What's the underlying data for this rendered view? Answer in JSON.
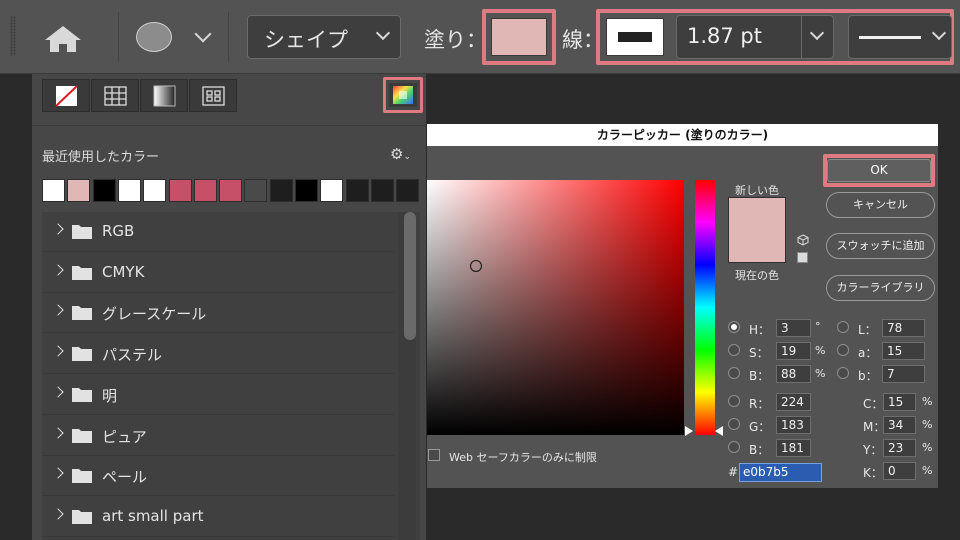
{
  "options_bar": {
    "shape_mode": "シェイプ",
    "fill_label": "塗り：",
    "fill_color": "#e0b7b5",
    "stroke_label": "線：",
    "stroke_width": "1.87 pt",
    "highlight_color": "#e07a82"
  },
  "swatch_panel": {
    "tabs": [
      "none-color-icon",
      "grid-icon",
      "gradient-icon",
      "pattern-icon",
      "color-picker-icon"
    ],
    "recent_label": "最近使用したカラー",
    "recent_colors": [
      "#ffffff",
      "#e0b7b5",
      "#000000",
      "#ffffff",
      "#ffffff",
      "#c65067",
      "#c65067",
      "#c65067",
      "#4a4a4a",
      "#1e1e1e",
      "#000000",
      "#ffffff",
      "#1e1e1e",
      "#1e1e1e",
      "#1e1e1e"
    ],
    "groups": [
      "RGB",
      "CMYK",
      "グレースケール",
      "パステル",
      "明",
      "ピュア",
      "ペール",
      "art small part"
    ]
  },
  "picker": {
    "title": "カラーピッカー (塗りのカラー)",
    "ok": "OK",
    "cancel": "キャンセル",
    "add_swatch": "スウォッチに追加",
    "libraries": "カラーライブラリ",
    "new_label": "新しい色",
    "current_label": "現在の色",
    "web_only": "Web セーフカラーのみに制限",
    "new_color": "#e0b7b5",
    "hsb": {
      "h_label": "H：",
      "h": "3",
      "h_unit": "°",
      "s_label": "S：",
      "s": "19",
      "s_unit": "%",
      "b_label": "B：",
      "b": "88",
      "b_unit": "%"
    },
    "lab": {
      "l_label": "L：",
      "l": "78",
      "a_label": "a：",
      "a": "15",
      "b_label": "b：",
      "b": "7"
    },
    "rgb": {
      "r_label": "R：",
      "r": "224",
      "g_label": "G：",
      "g": "183",
      "b_label": "B：",
      "b": "181"
    },
    "cmyk": {
      "c_label": "C：",
      "c": "15",
      "m_label": "M：",
      "m": "34",
      "y_label": "Y：",
      "y": "23",
      "k_label": "K：",
      "k": "0",
      "unit": "%"
    },
    "hex_label": "#",
    "hex": "e0b7b5"
  }
}
